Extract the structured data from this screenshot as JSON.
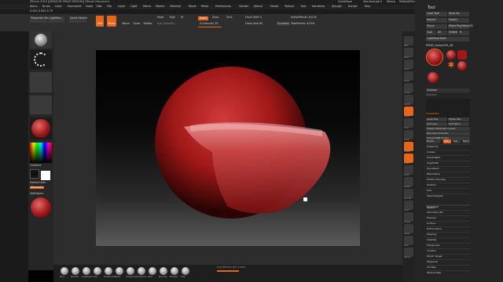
{
  "app": {
    "title": "ZBrush 2018 [[DRAGON SPACE DESIGN]] ZBrush Document",
    "menu_items": [
      "Alpha",
      "Brush",
      "Color",
      "Document",
      "Draw",
      "Edit",
      "File",
      "Layer",
      "Light",
      "Macro",
      "Marker",
      "Material",
      "Movie",
      "Picker",
      "Preferences",
      "Render",
      "Stencil",
      "Stroke",
      "Texture",
      "Tool",
      "Transform",
      "Zplugin",
      "Zscript",
      "Help"
    ],
    "top_right": [
      "QuickSave",
      "See-through 0",
      "Menus",
      "DefaultZScript"
    ],
    "coords_readout": "0.001,0.002,0.75"
  },
  "top_toolbar": {
    "projection_master": "Projection Master",
    "lightbox": "LightBox",
    "quick_sketch": "Quick Sketch",
    "buttons": [
      "Edit",
      "Draw",
      "Move",
      "Scale",
      "Rotate"
    ],
    "mrgb": "Mrgb",
    "rgb": "Rgb",
    "m": "M",
    "rgb_intensity": "Rgb Intensity",
    "zadd": "Zadd",
    "zsub": "Zsub",
    "zcut": "Zcut",
    "z_intensity": "Z Intensity 25",
    "focal_shift": "Focal Shift 0",
    "draw_size": "Draw Size 64",
    "dynamic": "Dynamic",
    "active_points": "ActivePoints: 6,016",
    "total_points": "TotalPoints: 6,016"
  },
  "left_shelf": {
    "labels": [
      "Gradient",
      "SwitchColor",
      "Alternate",
      "MatObject"
    ]
  },
  "right_icons": [
    "BPR",
    "SPix 3",
    "Scroll",
    "Zoom",
    "Actual",
    "AAHalf",
    "Persp",
    "Floor",
    "Local",
    "Frame",
    "Move",
    "Scale",
    "Rotate",
    "Line Fill",
    "PolyF",
    "Transp",
    "Ghost",
    "Solo",
    "Xpose"
  ],
  "tool_panel": {
    "title": "Tool",
    "buttons": [
      [
        "Load Tool",
        "Save As"
      ],
      [
        "Import",
        "Export"
      ],
      [
        "Clone",
        "Make PolyMesh3D"
      ],
      [
        "GoZ",
        "All",
        "Visible",
        "R"
      ],
      [
        "Lightbox▸Tools"
      ]
    ],
    "tool_name": "PM3D_Sphere3D_48",
    "subtools_title": "Subtool",
    "subtool_items": [
      "Geometry",
      "Geometry HD",
      "Preview",
      "Surface",
      "Deformation",
      "Masking",
      "Visibility",
      "Polygroups",
      "Contact",
      "Morph Target",
      "Polypaint",
      "UV Map",
      "Texture Map"
    ],
    "subtool_label": "Subtool",
    "geometry_title": "Geometry",
    "geometry_items": [
      "Lower Res",
      "Higher Res",
      "Del Lower",
      "Del Higher",
      "Freeze SubDivision Levels",
      "Reconstruct Subdiv",
      "Convert BPR To Geo",
      "Divide",
      "Smt",
      "Suv",
      "ReUV"
    ],
    "sections": [
      "EdgeLoop",
      "Crease",
      "ShadowBox",
      "ClayPolish",
      "DynaMesh",
      "ZRemesher",
      "Modify Topology",
      "Position",
      "Size",
      "MeshIntegrity",
      "Layers",
      "FiberMesh",
      "Geometry HD",
      "Preview",
      "Surface",
      "Deformation",
      "Masking",
      "Visibility",
      "Polygroups",
      "Contact",
      "Morph Target",
      "Polypaint",
      "UV Map",
      "Texture Map"
    ]
  },
  "bottom_shelf": {
    "brushes": [
      "Move",
      "Standard",
      "ClayBuildup",
      "Inflat",
      "DamStandard",
      "hPolish",
      "TrimDynamic",
      "SnakeHook",
      "Pinch",
      "Move Top",
      "ZModeler",
      "Slash"
    ],
    "hint": "LazyMouse  gr0  Lasso"
  },
  "colors": {
    "accent": "#e8661a",
    "sphere": "#a01818",
    "ui_bg": "#2b2b2b"
  }
}
